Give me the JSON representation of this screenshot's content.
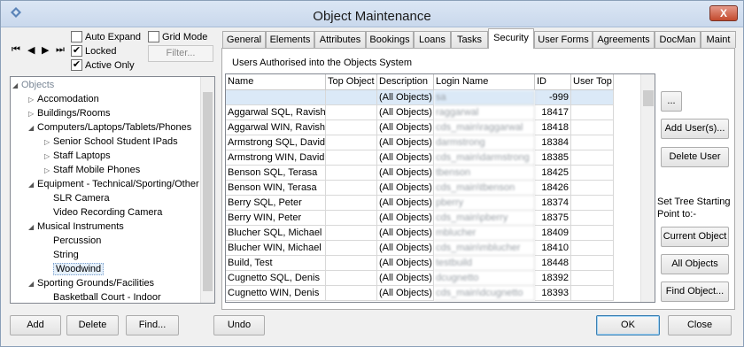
{
  "window": {
    "title": "Object Maintenance",
    "close_label": "X"
  },
  "nav": {
    "first": "⏮",
    "prev": "◀",
    "next": "▶",
    "last": "⏭"
  },
  "options": {
    "auto_expand": {
      "label": "Auto Expand",
      "checked": false
    },
    "locked": {
      "label": "Locked",
      "checked": true
    },
    "active_only": {
      "label": "Active Only",
      "checked": true
    },
    "grid_mode": {
      "label": "Grid Mode",
      "checked": false
    },
    "filter_label": "Filter..."
  },
  "tree": {
    "items": [
      {
        "label": "Objects",
        "level": 0,
        "expander": "◢",
        "muted": true
      },
      {
        "label": "Accomodation",
        "level": 1,
        "expander": "▷"
      },
      {
        "label": "Buildings/Rooms",
        "level": 1,
        "expander": "▷"
      },
      {
        "label": "Computers/Laptops/Tablets/Phones",
        "level": 1,
        "expander": "◢"
      },
      {
        "label": "Senior School Student IPads",
        "level": 2,
        "expander": "▷"
      },
      {
        "label": "Staff Laptops",
        "level": 2,
        "expander": "▷"
      },
      {
        "label": "Staff Mobile Phones",
        "level": 2,
        "expander": "▷"
      },
      {
        "label": "Equipment - Technical/Sporting/Other",
        "level": 1,
        "expander": "◢"
      },
      {
        "label": "SLR Camera",
        "level": 2,
        "expander": ""
      },
      {
        "label": "Video Recording Camera",
        "level": 2,
        "expander": ""
      },
      {
        "label": "Musical Instruments",
        "level": 1,
        "expander": "◢"
      },
      {
        "label": "Percussion",
        "level": 2,
        "expander": ""
      },
      {
        "label": "String",
        "level": 2,
        "expander": ""
      },
      {
        "label": "Woodwind",
        "level": 2,
        "expander": "",
        "selected": true
      },
      {
        "label": "Sporting Grounds/Facilities",
        "level": 1,
        "expander": "◢"
      },
      {
        "label": "Basketball Court - Indoor",
        "level": 2,
        "expander": ""
      }
    ]
  },
  "tabs": [
    "General",
    "Elements",
    "Attributes",
    "Bookings",
    "Loans",
    "Tasks",
    "Security",
    "User Forms",
    "Agreements",
    "DocMan",
    "Maint"
  ],
  "active_tab": "Security",
  "security": {
    "heading": "Users Authorised into the Objects System",
    "columns": [
      "Name",
      "Top Object",
      "Description",
      "Login Name",
      "ID",
      "User Top"
    ],
    "rows": [
      {
        "name": "",
        "top": "",
        "desc": "(All Objects)",
        "login": "sa",
        "id": "-999",
        "usertop": ""
      },
      {
        "name": "Aggarwal SQL, Ravish",
        "top": "",
        "desc": "(All Objects)",
        "login": "raggarwal",
        "id": "18417",
        "usertop": ""
      },
      {
        "name": "Aggarwal WIN, Ravish",
        "top": "",
        "desc": "(All Objects)",
        "login": "cds_main\\raggarwal",
        "id": "18418",
        "usertop": ""
      },
      {
        "name": "Armstrong SQL, David",
        "top": "",
        "desc": "(All Objects)",
        "login": "darmstrong",
        "id": "18384",
        "usertop": ""
      },
      {
        "name": "Armstrong WIN, David",
        "top": "",
        "desc": "(All Objects)",
        "login": "cds_main\\darmstrong",
        "id": "18385",
        "usertop": ""
      },
      {
        "name": "Benson SQL, Terasa",
        "top": "",
        "desc": "(All Objects)",
        "login": "tbenson",
        "id": "18425",
        "usertop": ""
      },
      {
        "name": "Benson WIN, Terasa",
        "top": "",
        "desc": "(All Objects)",
        "login": "cds_main\\tbenson",
        "id": "18426",
        "usertop": ""
      },
      {
        "name": "Berry SQL, Peter",
        "top": "",
        "desc": "(All Objects)",
        "login": "pberry",
        "id": "18374",
        "usertop": ""
      },
      {
        "name": "Berry WIN, Peter",
        "top": "",
        "desc": "(All Objects)",
        "login": "cds_main\\pberry",
        "id": "18375",
        "usertop": ""
      },
      {
        "name": "Blucher SQL, Michael",
        "top": "",
        "desc": "(All Objects)",
        "login": "mblucher",
        "id": "18409",
        "usertop": ""
      },
      {
        "name": "Blucher WIN, Michael",
        "top": "",
        "desc": "(All Objects)",
        "login": "cds_main\\mblucher",
        "id": "18410",
        "usertop": ""
      },
      {
        "name": "Build, Test",
        "top": "",
        "desc": "(All Objects)",
        "login": "testbuild",
        "id": "18448",
        "usertop": ""
      },
      {
        "name": "Cugnetto SQL, Denis",
        "top": "",
        "desc": "(All Objects)",
        "login": "dcugnetto",
        "id": "18392",
        "usertop": ""
      },
      {
        "name": "Cugnetto WIN, Denis",
        "top": "",
        "desc": "(All Objects)",
        "login": "cds_main\\dcugnetto",
        "id": "18393",
        "usertop": ""
      }
    ]
  },
  "side": {
    "ellipsis": "...",
    "add_users": "Add User(s)...",
    "delete_user": "Delete User",
    "set_tree_label": "Set Tree Starting Point to:-",
    "current_object": "Current Object",
    "all_objects": "All Objects",
    "find_object": "Find Object..."
  },
  "footer": {
    "add": "Add",
    "delete": "Delete",
    "find": "Find...",
    "undo": "Undo",
    "ok": "OK",
    "close": "Close"
  }
}
